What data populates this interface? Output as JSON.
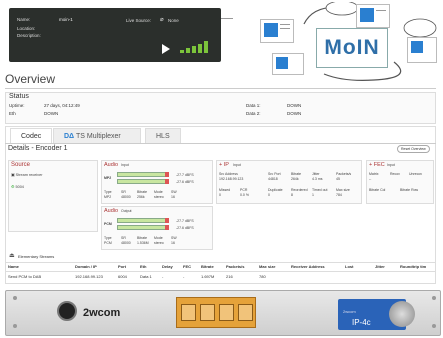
{
  "source_panel": {
    "name_label": "Name:",
    "name_value": "moin-1",
    "location_label": "Location:",
    "description_label": "Description:",
    "live_source_label": "Live Source:",
    "live_source_value": "None"
  },
  "diagram": {
    "logo_text": "MoIN"
  },
  "overview": {
    "title": "Overview",
    "status_title": "Status",
    "uptime_label": "Uptime:",
    "uptime_value": "27 days, 04:12:49",
    "eth_label": "Eth",
    "eth_value": "DOWN",
    "data1_label": "Data 1:",
    "data1_value": "DOWN",
    "data2_label": "Data 2:",
    "data2_value": "DOWN"
  },
  "tabs": [
    {
      "label": "Codec"
    },
    {
      "label": "TS Multiplexer"
    },
    {
      "label": "HLS"
    }
  ],
  "reset_button": "Reset Overview",
  "details_title": "Details - Encoder 1",
  "source_card": {
    "title": "Source",
    "stream_receiver": "Stream receiver",
    "port": "5004"
  },
  "audio_input": {
    "title": "Audio",
    "sub": "Input",
    "codec": "MP2",
    "level1": "-27.7 dBFS",
    "level2": "-27.6 dBFS",
    "type_label": "Type",
    "type_value": "MP2",
    "sr_label": "SR",
    "sr_value": "48000",
    "bitrate_label": "Bitrate",
    "bitrate_value": "256k",
    "mode_label": "Mode",
    "mode_value": "stereo",
    "sw_label": "SW",
    "sw_value": "16"
  },
  "audio_output": {
    "title": "Audio",
    "sub": "Output",
    "codec": "PCM",
    "level1": "-27.7 dBFS",
    "level2": "-27.6 dBFS",
    "type_label": "Type",
    "type_value": "PCM",
    "sr_label": "SR",
    "sr_value": "48000",
    "bitrate_label": "Bitrate",
    "bitrate_value": "1.536M",
    "mode_label": "Mode",
    "mode_value": "stereo",
    "sw_label": "SW",
    "sw_value": "16"
  },
  "ip_card": {
    "title": "+ IP",
    "sub": "Input",
    "src_address_label": "Src Address",
    "src_address_value": "192.168.99.123",
    "src_port_label": "Src Port",
    "src_port_value": "44818",
    "bitrate_label": "Bitrate",
    "bitrate_value": "264k",
    "jitter_label": "Jitter",
    "jitter_value": "4.3 ms",
    "packets_label": "Packets/s",
    "packets_value": "45",
    "missed_label": "Missed",
    "missed_value": "0",
    "pcr_label": "PCR",
    "pcr_value": "0.0 %",
    "duplicate_label": "Duplicate",
    "duplicate_value": "0",
    "reordered_label": "Reordered",
    "reordered_value": "8",
    "timedout_label": "Timed out",
    "timedout_value": "1",
    "maxsize_label": "Max size",
    "maxsize_value": "784"
  },
  "fec_card": {
    "title": "+ FEC",
    "sub": "Input",
    "matrix_label": "Matrix",
    "matrix_value": "--",
    "recov_label": "Recov",
    "unrecov_label": "Unrecov",
    "bitrate_col_label": "Bitrate Col",
    "bitrate_row_label": "Bitrate Row"
  },
  "elementary": {
    "title": "Elementary Streams",
    "headers": [
      "Name",
      "Domain / IP",
      "Port",
      "Eth",
      "Delay",
      "FEC",
      "Bitrate",
      "Packets/s",
      "Max size",
      "Receiver Address",
      "Lost",
      "Jitter",
      "Roundtrip tim"
    ],
    "row": [
      "Send PCM to DAB",
      "192.168.99.123",
      "6004",
      "Data 1",
      "-",
      "-",
      "1.697M",
      "216",
      "780",
      "",
      "",
      "",
      ""
    ]
  },
  "hardware": {
    "brand": "2wcom",
    "front_brand": "2wcom",
    "model": "IP-4c"
  },
  "colors": {
    "accent": "#2f6fa8",
    "panel": "#2b2f2c",
    "signal": "#7cc43b",
    "hardware_blue": "#2a63b8",
    "ports": "#e5a23a"
  }
}
